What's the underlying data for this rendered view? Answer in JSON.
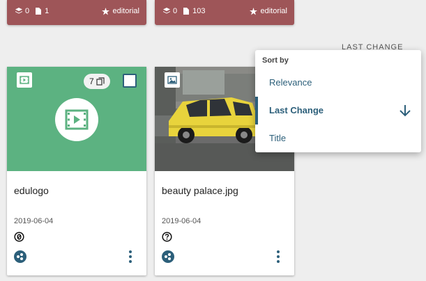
{
  "top_cards": [
    {
      "child_count": "0",
      "file_count": "1",
      "collection_type": "editorial"
    },
    {
      "child_count": "0",
      "file_count": "103",
      "collection_type": "editorial"
    }
  ],
  "sort_menu": {
    "heading": "Sort by",
    "background_label": "LAST CHANGE",
    "options": [
      {
        "label": "Relevance"
      },
      {
        "label": "Last Change",
        "active": true,
        "direction": "descending"
      },
      {
        "label": "Title"
      }
    ]
  },
  "cards": [
    {
      "title": "edulogo",
      "date": "2019-06-04",
      "usage_count": "7",
      "type_icon": "video-icon",
      "license_icon": "cc-zero-icon",
      "preview_color": "#5cb281"
    },
    {
      "title": "beauty palace.jpg",
      "date": "2019-06-04",
      "type_icon": "image-icon",
      "license_icon": "unknown-license-icon"
    }
  ],
  "colors": {
    "collection_card": "#9e5558",
    "accent": "#2c5f7a",
    "video_preview": "#5cb281"
  }
}
